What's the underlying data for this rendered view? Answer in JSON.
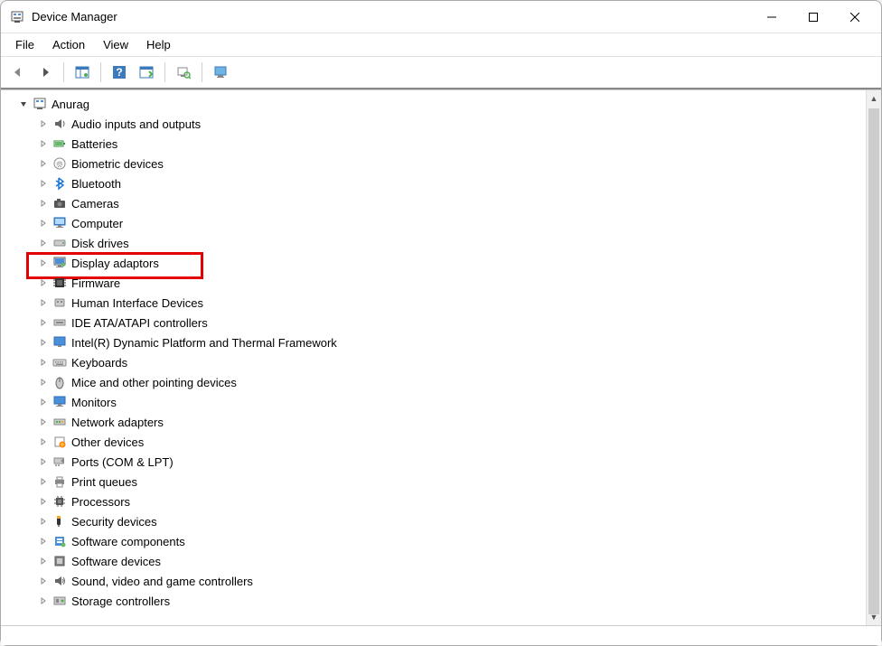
{
  "window": {
    "title": "Device Manager"
  },
  "menu": {
    "file": "File",
    "action": "Action",
    "view": "View",
    "help": "Help"
  },
  "toolbar": {
    "back": "back",
    "forward": "forward",
    "showhide": "showhide",
    "help": "help",
    "action": "action",
    "scan": "scan",
    "monitor": "monitor"
  },
  "tree": {
    "root": {
      "label": "Anurag"
    },
    "items": [
      {
        "label": "Audio inputs and outputs",
        "icon": "audio"
      },
      {
        "label": "Batteries",
        "icon": "battery"
      },
      {
        "label": "Biometric devices",
        "icon": "biometric"
      },
      {
        "label": "Bluetooth",
        "icon": "bluetooth"
      },
      {
        "label": "Cameras",
        "icon": "camera"
      },
      {
        "label": "Computer",
        "icon": "computer"
      },
      {
        "label": "Disk drives",
        "icon": "disk"
      },
      {
        "label": "Display adaptors",
        "icon": "display",
        "highlighted": true
      },
      {
        "label": "Firmware",
        "icon": "firmware"
      },
      {
        "label": "Human Interface Devices",
        "icon": "hid"
      },
      {
        "label": "IDE ATA/ATAPI controllers",
        "icon": "ide"
      },
      {
        "label": "Intel(R) Dynamic Platform and Thermal Framework",
        "icon": "intel"
      },
      {
        "label": "Keyboards",
        "icon": "keyboard"
      },
      {
        "label": "Mice and other pointing devices",
        "icon": "mouse"
      },
      {
        "label": "Monitors",
        "icon": "monitor"
      },
      {
        "label": "Network adapters",
        "icon": "network"
      },
      {
        "label": "Other devices",
        "icon": "other"
      },
      {
        "label": "Ports (COM & LPT)",
        "icon": "ports"
      },
      {
        "label": "Print queues",
        "icon": "printer"
      },
      {
        "label": "Processors",
        "icon": "cpu"
      },
      {
        "label": "Security devices",
        "icon": "security"
      },
      {
        "label": "Software components",
        "icon": "software"
      },
      {
        "label": "Software devices",
        "icon": "softdev"
      },
      {
        "label": "Sound, video and game controllers",
        "icon": "sound"
      },
      {
        "label": "Storage controllers",
        "icon": "storage"
      }
    ]
  }
}
